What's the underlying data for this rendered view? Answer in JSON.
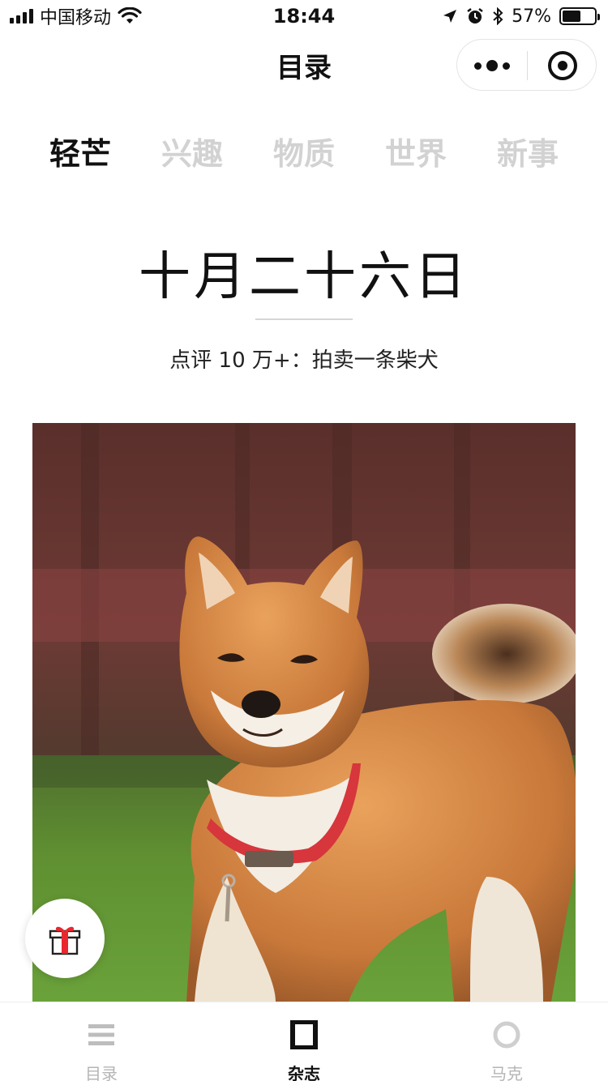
{
  "status_bar": {
    "carrier": "中国移动",
    "time": "18:44",
    "battery_percent": "57%",
    "battery_level": 0.57
  },
  "nav": {
    "title": "目录"
  },
  "tabs": [
    {
      "label": "轻芒",
      "active": true
    },
    {
      "label": "兴趣",
      "active": false
    },
    {
      "label": "物质",
      "active": false
    },
    {
      "label": "世界",
      "active": false
    },
    {
      "label": "新事",
      "active": false
    }
  ],
  "article": {
    "date": "十月二十六日",
    "subtitle": "点评 10 万+：拍卖一条柴犬",
    "image_alt": "shiba-inu-photo"
  },
  "tabbar": {
    "items": [
      {
        "label": "目录",
        "icon": "list-icon",
        "active": false
      },
      {
        "label": "杂志",
        "icon": "square-icon",
        "active": true
      },
      {
        "label": "马克",
        "icon": "circle-icon",
        "active": false
      }
    ]
  },
  "colors": {
    "active_text": "#111111",
    "inactive_tab": "#d2d2d2",
    "inactive_tabbar": "#b5b5b5",
    "gift_red": "#e8282e"
  }
}
